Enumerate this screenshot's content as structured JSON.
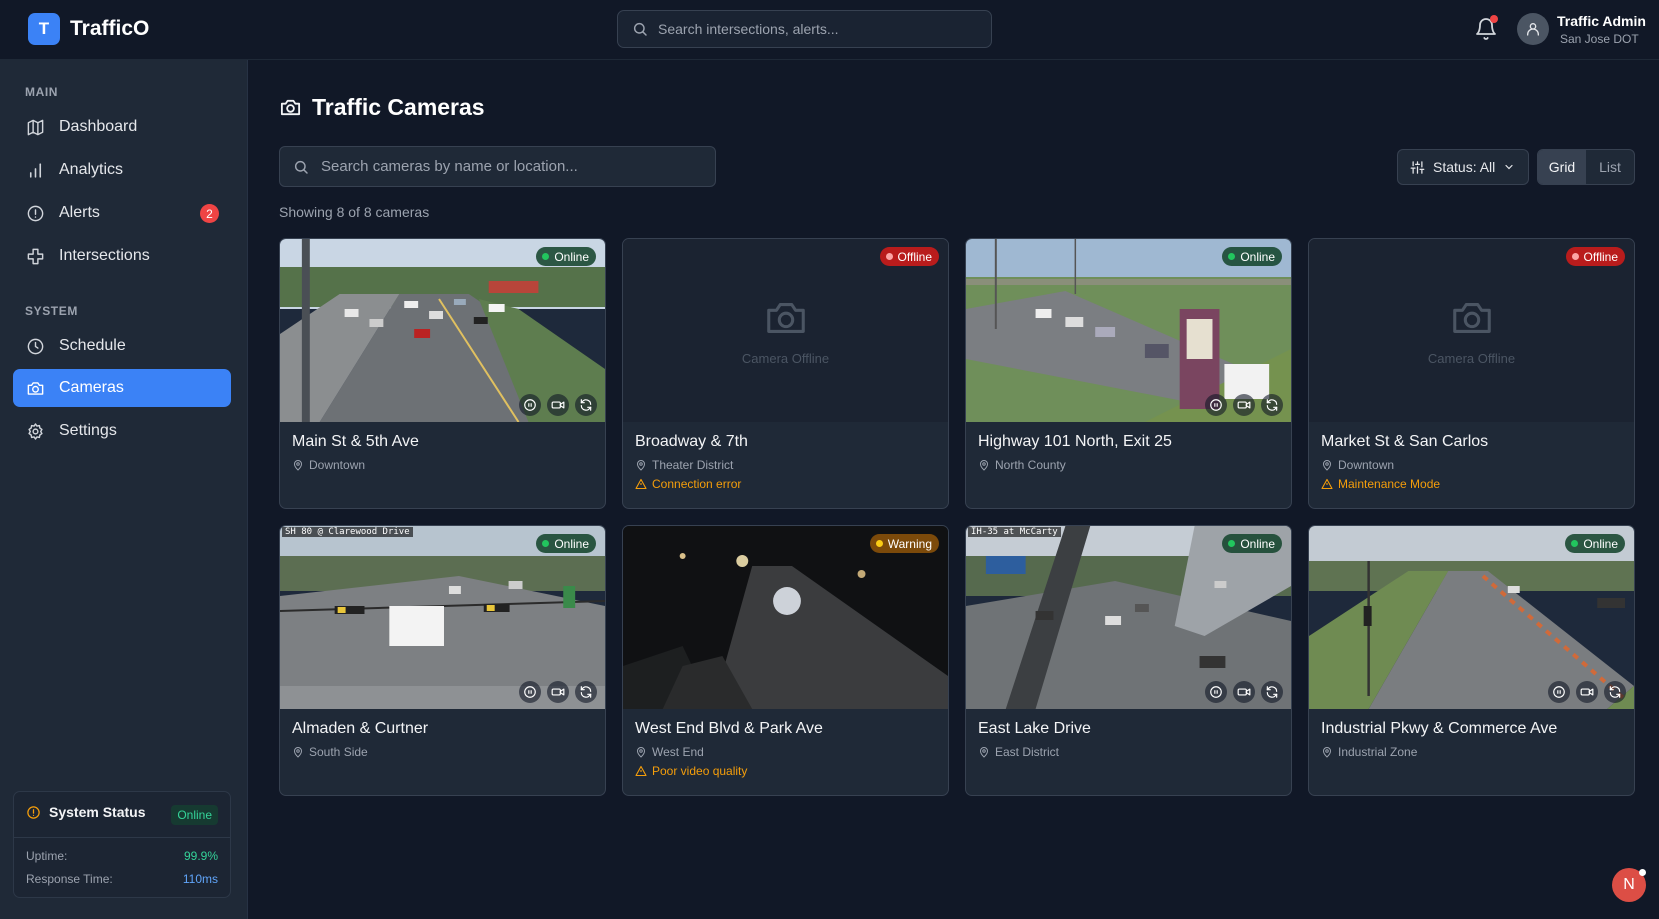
{
  "brand": {
    "logo_letter": "T",
    "name": "TrafficO"
  },
  "header": {
    "search_placeholder": "Search intersections, alerts...",
    "user_name": "Traffic Admin",
    "user_org": "San Jose DOT"
  },
  "sidebar": {
    "main_label": "MAIN",
    "system_label": "SYSTEM",
    "items": [
      {
        "label": "Dashboard",
        "icon": "map-icon"
      },
      {
        "label": "Analytics",
        "icon": "bar-chart-icon"
      },
      {
        "label": "Alerts",
        "icon": "alert-circle-icon",
        "badge": "2"
      },
      {
        "label": "Intersections",
        "icon": "intersection-icon"
      },
      {
        "label": "Schedule",
        "icon": "clock-icon"
      },
      {
        "label": "Cameras",
        "icon": "camera-icon",
        "active": true
      },
      {
        "label": "Settings",
        "icon": "gear-icon"
      }
    ],
    "status": {
      "title": "System Status",
      "state": "Online",
      "uptime_label": "Uptime:",
      "uptime_value": "99.9%",
      "response_label": "Response Time:",
      "response_value": "110ms"
    }
  },
  "page": {
    "title": "Traffic Cameras",
    "search_placeholder": "Search cameras by name or location...",
    "status_filter": "Status: All",
    "view_grid": "Grid",
    "view_list": "List",
    "showing": "Showing 8 of 8 cameras",
    "offline_text": "Camera Offline"
  },
  "cameras": [
    {
      "name": "Main St & 5th Ave",
      "location": "Downtown",
      "status": "Online",
      "issue": ""
    },
    {
      "name": "Broadway & 7th",
      "location": "Theater District",
      "status": "Offline",
      "issue": "Connection error"
    },
    {
      "name": "Highway 101 North, Exit 25",
      "location": "North County",
      "status": "Online",
      "issue": ""
    },
    {
      "name": "Market St & San Carlos",
      "location": "Downtown",
      "status": "Offline",
      "issue": "Maintenance Mode"
    },
    {
      "name": "Almaden & Curtner",
      "location": "South Side",
      "status": "Online",
      "issue": "",
      "overlay": "SH 80 @ Clarewood Drive"
    },
    {
      "name": "West End Blvd & Park Ave",
      "location": "West End",
      "status": "Warning",
      "issue": "Poor video quality"
    },
    {
      "name": "East Lake Drive",
      "location": "East District",
      "status": "Online",
      "issue": "",
      "overlay": "IH-35 at McCarty"
    },
    {
      "name": "Industrial Pkwy & Commerce Ave",
      "location": "Industrial Zone",
      "status": "Online",
      "issue": ""
    }
  ],
  "fab": {
    "letter": "N"
  },
  "colors": {
    "accent": "#3b82f6",
    "online": "#22c55e",
    "offline": "#dc2626",
    "warning": "#f59e0b",
    "background": "#111827",
    "surface": "#1f2937"
  }
}
